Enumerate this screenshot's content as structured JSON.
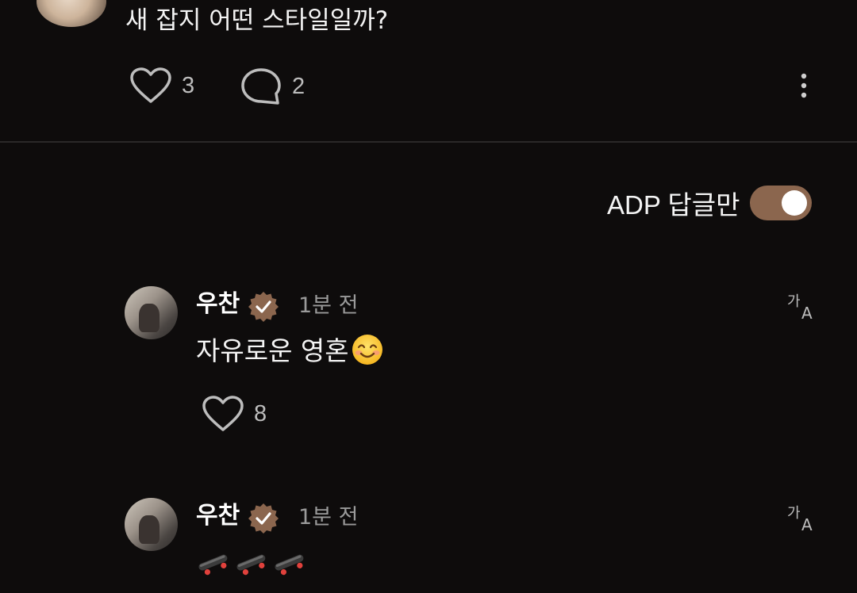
{
  "post": {
    "text": "새 잡지 어떤 스타일일까?",
    "like_count": "3",
    "comment_count": "2"
  },
  "filter": {
    "label": "ADP 답글만",
    "enabled": true
  },
  "replies": [
    {
      "author": "우찬",
      "verified": true,
      "time": "1분 전",
      "text": "자유로운 영혼",
      "emoji": "smiling-face-icon",
      "like_count": "8"
    },
    {
      "author": "우찬",
      "verified": true,
      "time": "1분 전",
      "emoji": "skateboard-icon x3"
    }
  ],
  "colors": {
    "background": "#0e0c0c",
    "accent": "#8b664e",
    "muted_text": "#9a9a9a",
    "divider": "#2a2828"
  }
}
